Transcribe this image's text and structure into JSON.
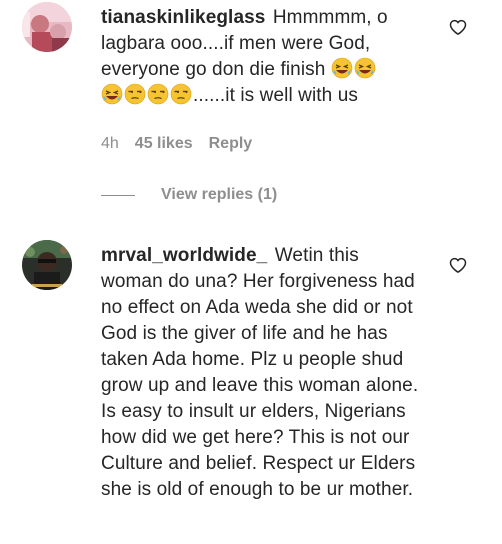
{
  "colors": {
    "text": "#262626",
    "muted": "#8e8e8e",
    "background": "#ffffff"
  },
  "comments": [
    {
      "username": "tianaskinlikeglass",
      "text_part1": "Hmmmmm, o lagbara ooo....if men were God, everyone go don die finish",
      "emojis_part1": [
        "grinning-squinting-face-with-sweat",
        "grinning-squinting-face-with-sweat"
      ],
      "emojis_part2": [
        "grinning-squinting-face-with-sweat",
        "unamused-face",
        "unamused-face",
        "unamused-face"
      ],
      "text_part2": "......it is well with us",
      "time": "4h",
      "likes": "45 likes",
      "reply_label": "Reply",
      "view_replies": "View replies (1)",
      "avatar_icon": "profile-photo",
      "like_icon": "heart-outline-icon"
    },
    {
      "username": "mrval_worldwide_",
      "text": "Wetin this woman do una? Her forgiveness had no effect on Ada weda she did or not God is the giver of life and he has taken Ada home. Plz u people shud grow up and leave this woman alone. Is easy to insult ur elders, Nigerians how did we get here? This is not our Culture and belief. Respect ur Elders she is old of enough to be ur mother.",
      "avatar_icon": "profile-photo",
      "like_icon": "heart-outline-icon"
    }
  ]
}
